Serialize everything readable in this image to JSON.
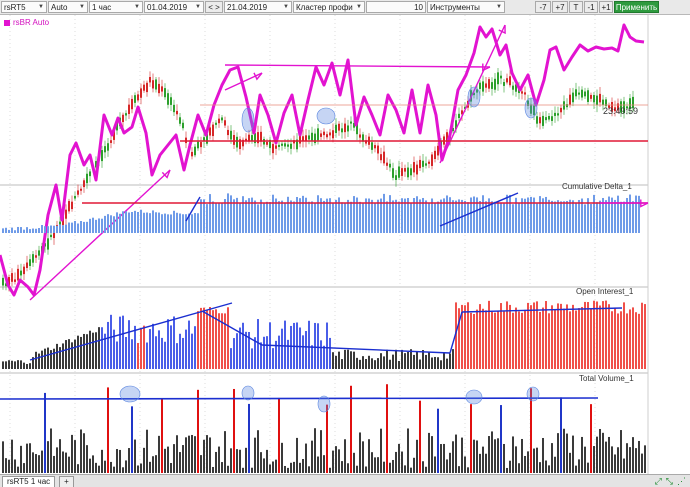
{
  "toolbar": {
    "symbol": "rsRT5",
    "mode": "Auto",
    "interval": "1 час",
    "date_from": "01.04.2019",
    "nav": "< >",
    "date_to": "21.04.2019",
    "cluster": "Кластер профи",
    "value": "10",
    "tools": "Инструменты",
    "btn_minus7": "-7",
    "btn_plus7": "+7",
    "btn_t": "T",
    "btn_minus1": "-1",
    "btn_plus1": "+1",
    "apply": "Применить"
  },
  "legend": {
    "label": "rsBR Auto"
  },
  "price_panel": {
    "time_label": "23:49:59"
  },
  "panels": {
    "cumdelta": "Cumulative Delta_1",
    "oi": "Open Interest_1",
    "volume": "Total Volume_1"
  },
  "bottom": {
    "tab": "rsRT5 1 час",
    "add": "+"
  },
  "colors": {
    "up": "#2ca02c",
    "down": "#d62728",
    "overlay": "#e213d0",
    "delta": "#6f9be8",
    "oi_red": "#f0504a",
    "oi_blue": "#4a5ee8",
    "vol_dark": "#3a3a3a",
    "vol_red": "#e01010",
    "trend_blue": "#1b2fd0",
    "level_red": "#e01836"
  }
}
